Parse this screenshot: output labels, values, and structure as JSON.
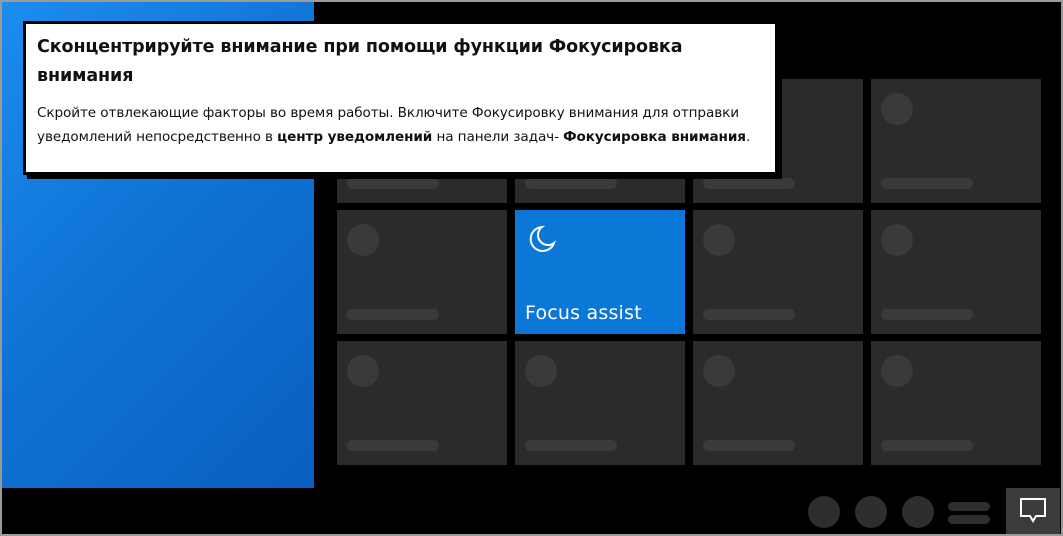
{
  "tooltip": {
    "title": "Сконцентрируйте внимание при помощи функции Фокусировка внимания",
    "body_part1": "Скройте отвлекающие факторы во время работы. Включите Фокусировку внимания для отправки уведомлений непосредственно в ",
    "body_bold1": "центр уведомлений",
    "body_part2": " на панели задач- ",
    "body_bold2": "Фокусировка внимания",
    "body_end": "."
  },
  "action_center": {
    "active_tile_label": "Focus assist",
    "active_tile_icon": "moon-icon",
    "accent_color": "#0b78d7",
    "tile_color": "#2b2b2b"
  },
  "taskbar": {
    "notification_icon": "notification-icon"
  }
}
